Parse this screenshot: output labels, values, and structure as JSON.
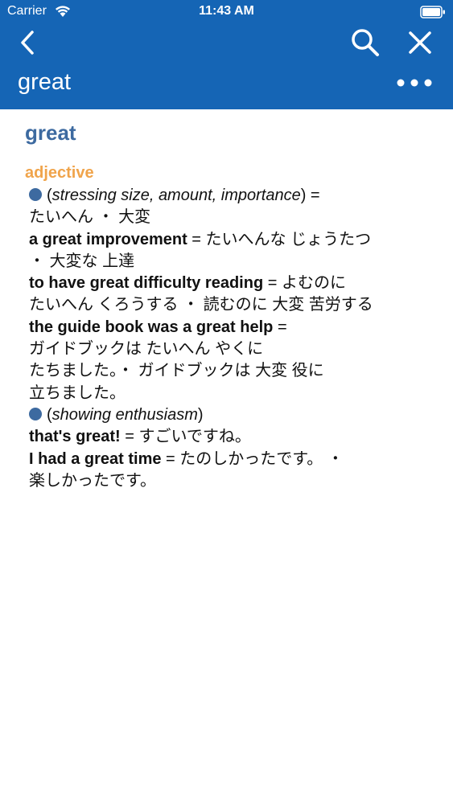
{
  "status": {
    "carrier": "Carrier",
    "time": "11:43 AM"
  },
  "nav": {
    "title": "great"
  },
  "entry": {
    "headword": "great",
    "pos": "adjective",
    "senses": [
      {
        "gloss": "stressing size, amount, importance",
        "translation": "たいへん ・ 大変",
        "examples": [
          {
            "en": "a great improvement",
            "ja1": "たいへんな じょうたつ",
            "ja2": "・ 大変な 上達"
          },
          {
            "en": "to have great difficulty reading",
            "ja1": "よむのに",
            "ja2": "たいへん くろうする ・ 読むのに 大変 苦労する"
          },
          {
            "en": "the guide book was a great help",
            "ja1": "ガイドブックは たいへん やくに",
            "ja2": "たちました。・ ガイドブックは 大変 役に",
            "ja3": "立ちました。"
          }
        ]
      },
      {
        "gloss": "showing enthusiasm",
        "examples": [
          {
            "en": "that's great!",
            "ja1": "すごいですね。"
          },
          {
            "en": "I had a great time",
            "ja1": "たのしかったです。 ・",
            "ja2": "楽しかったです。"
          }
        ]
      }
    ]
  }
}
